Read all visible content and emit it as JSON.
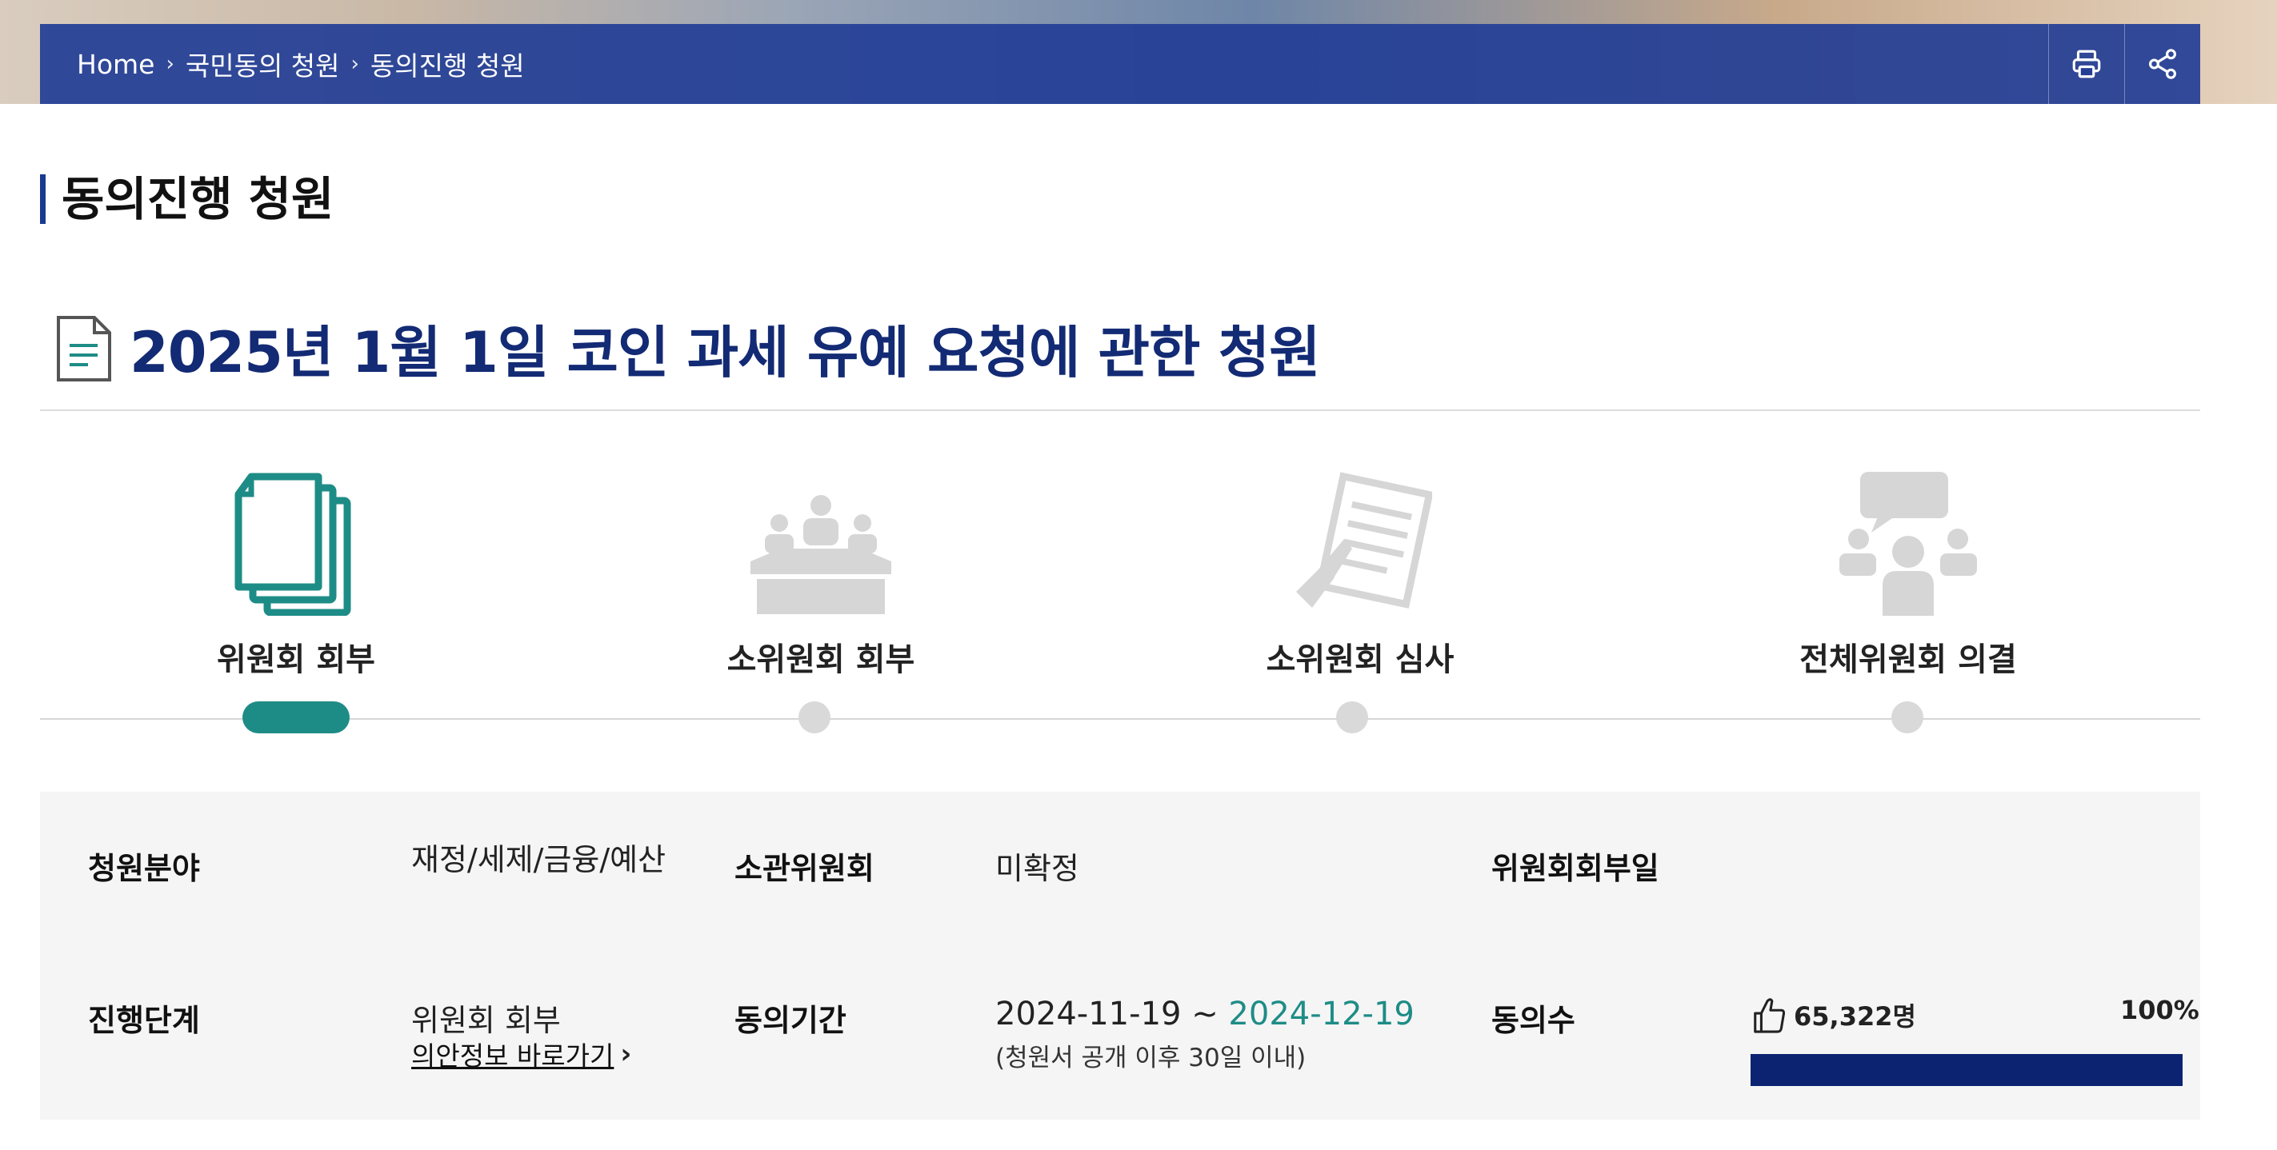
{
  "breadcrumb": [
    "Home",
    "국민동의 청원",
    "동의진행 청원"
  ],
  "section_title": "동의진행 청원",
  "petition_title": "2025년 1월 1일 코인 과세 유예 요청에 관한 청원",
  "actions": {
    "print": "print-icon",
    "share": "share-icon"
  },
  "steps": [
    {
      "label": "위원회 회부",
      "icon": "documents-icon",
      "active": true
    },
    {
      "label": "소위원회 회부",
      "icon": "meeting-icon",
      "active": false
    },
    {
      "label": "소위원회 심사",
      "icon": "review-icon",
      "active": false
    },
    {
      "label": "전체위원회 의결",
      "icon": "discussion-icon",
      "active": false
    }
  ],
  "info": {
    "field_label": "청원분야",
    "field_value": "재정/세제/금융/예산",
    "committee_label": "소관위원회",
    "committee_value": "미확정",
    "referral_date_label": "위원회회부일",
    "referral_date_value": "",
    "stage_label": "진행단계",
    "stage_value": "위원회 회부",
    "bill_link": "의안정보 바로가기",
    "period_label": "동의기간",
    "period_start": "2024-11-19",
    "period_sep": "~",
    "period_end": "2024-12-19",
    "period_note": "(청원서 공개 이후 30일 이내)",
    "agree_label": "동의수",
    "agree_count": "65,322명",
    "agree_percent": "100%",
    "agree_progress": 1.0
  },
  "colors": {
    "navy": "#132a74",
    "teal": "#1e8c86",
    "bar": "#0b2371"
  }
}
